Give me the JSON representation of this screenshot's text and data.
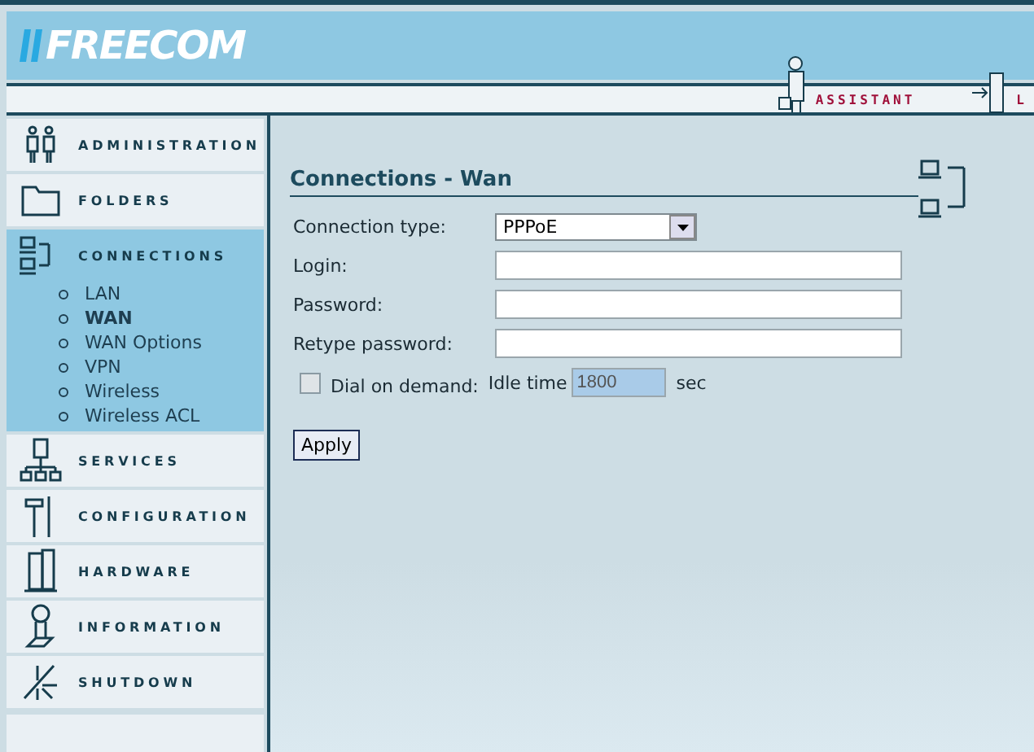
{
  "header": {
    "logo": "FREECOM",
    "links": [
      {
        "kind": "assistant",
        "label": "ASSISTANT"
      },
      {
        "kind": "logout",
        "label": "L"
      }
    ]
  },
  "sidebar": {
    "items": [
      {
        "kind": "admin",
        "label": "ADMINISTRATION",
        "selected": false
      },
      {
        "kind": "folders",
        "label": "FOLDERS",
        "selected": false
      },
      {
        "kind": "connections",
        "label": "CONNECTIONS",
        "selected": true,
        "children": [
          {
            "label": "LAN",
            "selected": false
          },
          {
            "label": "WAN",
            "selected": true
          },
          {
            "label": "WAN Options",
            "selected": false
          },
          {
            "label": "VPN",
            "selected": false
          },
          {
            "label": "Wireless",
            "selected": false
          },
          {
            "label": "Wireless ACL",
            "selected": false
          }
        ]
      },
      {
        "kind": "services",
        "label": "SERVICES",
        "selected": false
      },
      {
        "kind": "configuration",
        "label": "CONFIGURATION",
        "selected": false
      },
      {
        "kind": "hardware",
        "label": "HARDWARE",
        "selected": false
      },
      {
        "kind": "information",
        "label": "INFORMATION",
        "selected": false
      },
      {
        "kind": "shutdown",
        "label": "SHUTDOWN",
        "selected": false
      }
    ]
  },
  "content": {
    "title": "Connections - Wan",
    "fields": [
      {
        "kind": "select",
        "label": "Connection type:",
        "value": "PPPoE"
      },
      {
        "kind": "text",
        "label": "Login:"
      },
      {
        "kind": "text",
        "label": "Password:"
      },
      {
        "kind": "text",
        "label": "Retype password:"
      }
    ],
    "dial_on_demand": {
      "label": "Dial on demand:",
      "checked": false
    },
    "idle_time": {
      "label": "Idle time",
      "value": "1800",
      "unit": "sec",
      "disabled": true
    },
    "apply_button": "Apply"
  }
}
